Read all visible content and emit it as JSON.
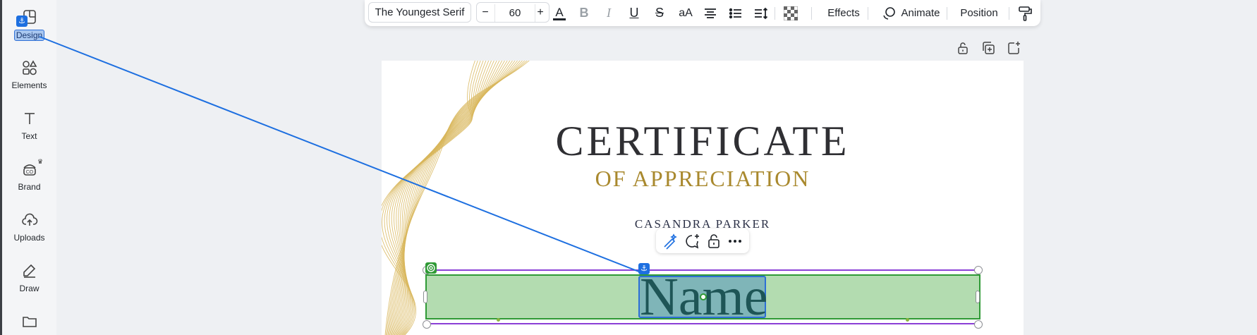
{
  "sidebar": {
    "items": [
      {
        "label": "Design",
        "icon": "design-icon"
      },
      {
        "label": "Elements",
        "icon": "elements-icon"
      },
      {
        "label": "Text",
        "icon": "text-icon"
      },
      {
        "label": "Brand",
        "icon": "brand-icon"
      },
      {
        "label": "Uploads",
        "icon": "uploads-icon"
      },
      {
        "label": "Draw",
        "icon": "draw-icon"
      },
      {
        "label": "",
        "icon": "folder-icon"
      }
    ]
  },
  "toolbar": {
    "font_name": "The Youngest Serif",
    "font_size": "60",
    "decrease_label": "−",
    "increase_label": "+",
    "case_label": "aA",
    "effects_label": "Effects",
    "animate_label": "Animate",
    "position_label": "Position"
  },
  "certificate": {
    "title": "CERTIFICATE",
    "subtitle": "OF APPRECIATION",
    "signer": "CASANDRA PARKER",
    "name_placeholder": "Name"
  },
  "colors": {
    "accent_blue": "#1d6fe0",
    "selection_green": "#2f9a36",
    "bound_purple": "#8b3fd6",
    "gold": "#a9892e"
  }
}
